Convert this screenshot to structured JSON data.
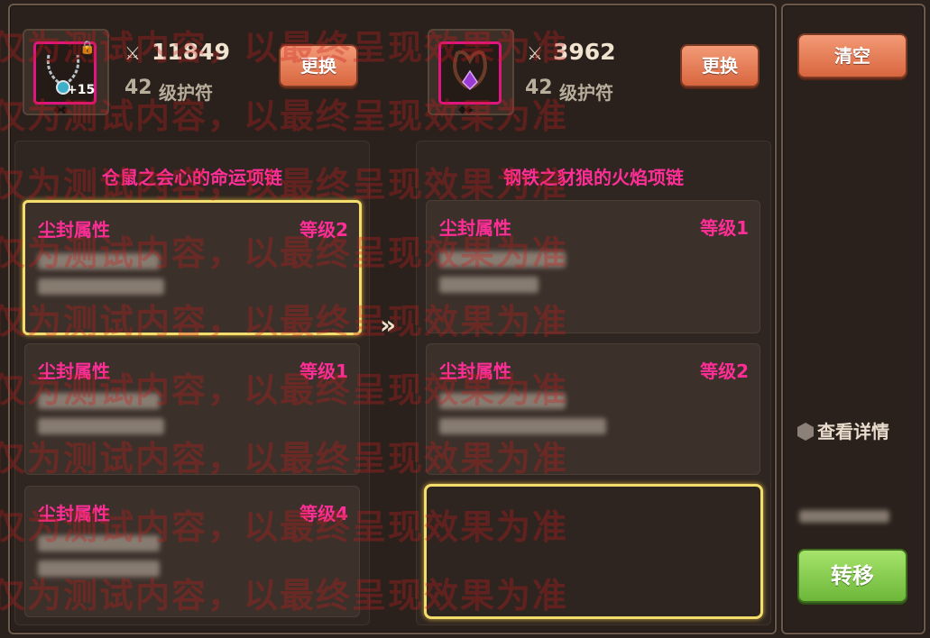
{
  "left_item": {
    "power": "11849",
    "level": "42",
    "type": "级护符",
    "enhance": "+15",
    "title": "仓鼠之会心的命运项链"
  },
  "right_item": {
    "power": "3962",
    "level": "42",
    "type": "级护符",
    "title": "钢铁之豺狼的火焰项链"
  },
  "buttons": {
    "replace": "更换",
    "clear": "清空",
    "transfer": "转移"
  },
  "arrow_label": "»",
  "view_details": "查看详情",
  "left_cards": [
    {
      "title": "尘封属性",
      "level": "等级2"
    },
    {
      "title": "尘封属性",
      "level": "等级1"
    },
    {
      "title": "尘封属性",
      "level": "等级4"
    }
  ],
  "right_cards": [
    {
      "title": "尘封属性",
      "level": "等级1"
    },
    {
      "title": "尘封属性",
      "level": "等级2"
    }
  ],
  "watermark": "仅为测试内容，以最终呈现效果为准",
  "icons": [
    "crossed-swords-icon",
    "lock-icon",
    "info-hex-icon",
    "necklace-icon",
    "amulet-icon"
  ],
  "colors": {
    "accent_pink": "#ff2e97",
    "highlight_yellow": "#f3dd6c",
    "button_orange": "#e57a50",
    "button_green": "#8bcf50"
  }
}
